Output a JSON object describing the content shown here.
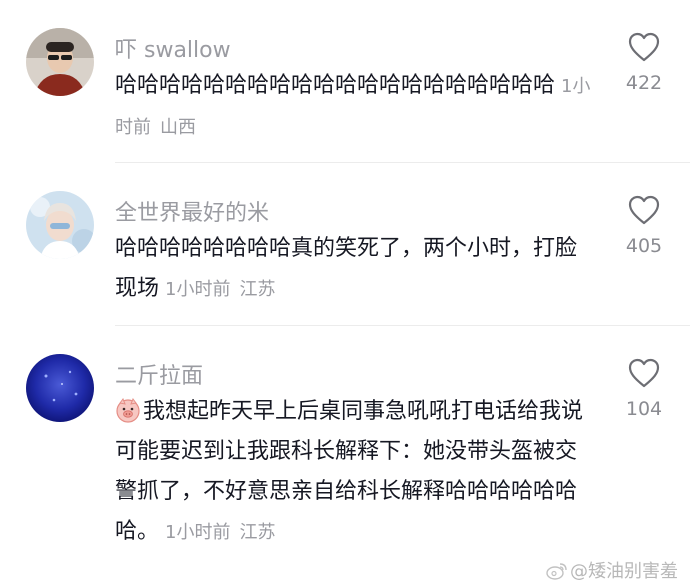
{
  "comments": [
    {
      "username": "吓 swallow",
      "text": "哈哈哈哈哈哈哈哈哈哈哈哈哈哈哈哈哈哈哈哈",
      "time": "1小时前",
      "location": "山西",
      "likes": "422"
    },
    {
      "username": "全世界最好的米",
      "text": "哈哈哈哈哈哈哈哈真的笑死了，两个小时，打脸现场",
      "time": "1小时前",
      "location": "江苏",
      "likes": "405"
    },
    {
      "username": "二斤拉面",
      "text": "我想起昨天早上后桌同事急吼吼打电话给我说可能要迟到让我跟科长解释下：她没带头盔被交警抓了，不好意思亲自给科长解释哈哈哈哈哈哈哈。",
      "time": "1小时前",
      "location": "江苏",
      "likes": "104",
      "emoji": "pig-face-emoji"
    }
  ],
  "icons": {
    "like": "heart-outline-icon",
    "watermark": "weibo-logo-icon"
  },
  "watermark": "@矮油别害羞"
}
